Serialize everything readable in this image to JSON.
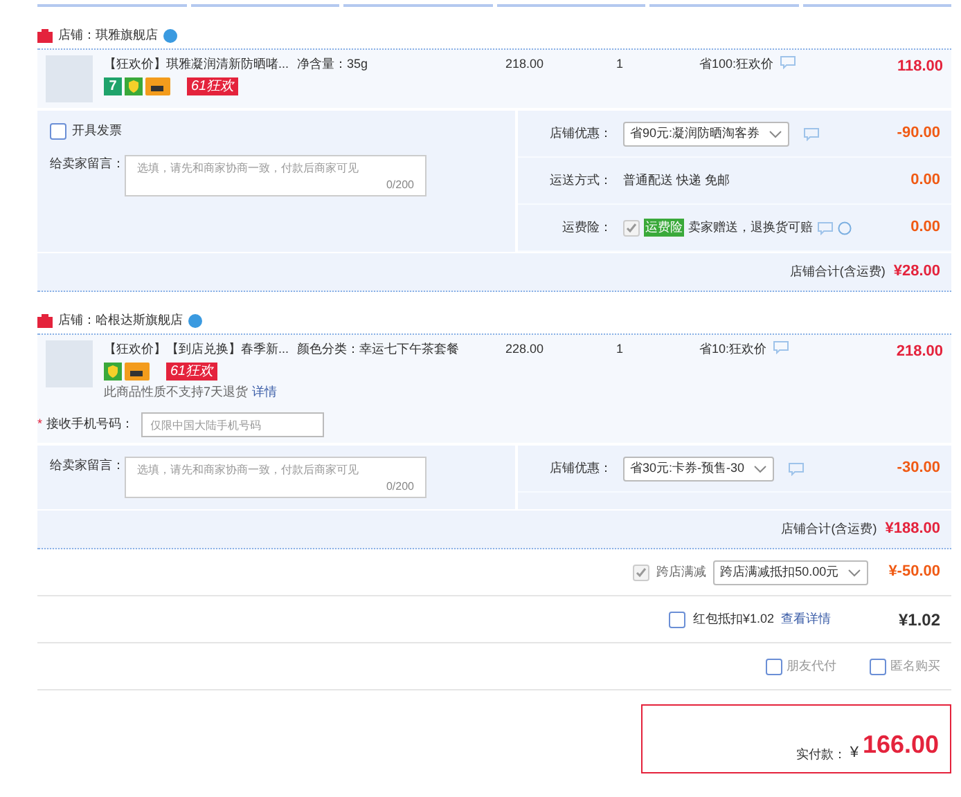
{
  "stores": [
    {
      "name": "店铺：琪雅旗舰店",
      "product": {
        "title": "【狂欢价】琪雅凝润清新防晒啫...",
        "spec": "净含量：35g",
        "price": "218.00",
        "qty": "1",
        "discount": "省100:狂欢价",
        "subtotal": "118.00",
        "badges": [
          {
            "kind": "seven",
            "text": "7"
          },
          {
            "kind": "shield"
          },
          {
            "kind": "card"
          },
          {
            "kind": "promo",
            "text": "61狂欢"
          }
        ]
      },
      "invoice": {
        "label": "开具发票",
        "checked": false
      },
      "message": {
        "label": "给卖家留言：",
        "placeholder": "选填，请先和商家协商一致，付款后商家可见",
        "counter": "0/200"
      },
      "options": [
        {
          "kind": "select",
          "label": "店铺优惠：",
          "value": "省90元:凝润防晒淘客券",
          "amount": "-90.00"
        },
        {
          "kind": "text",
          "label": "运送方式：",
          "value": "普通配送 快递 免邮",
          "amount": "0.00"
        },
        {
          "kind": "insurance",
          "label": "运费险：",
          "checked": true,
          "tag": "运费险",
          "value": "卖家赠送，退换货可赔",
          "amount": "0.00"
        }
      ],
      "total_label": "店铺合计(含运费)",
      "total": "¥28.00"
    },
    {
      "name": "店铺：哈根达斯旗舰店",
      "product": {
        "title": "【狂欢价】【到店兑换】春季新...",
        "spec": "颜色分类：幸运七下午茶套餐",
        "price": "228.00",
        "qty": "1",
        "discount": "省10:狂欢价",
        "subtotal": "218.00",
        "badges": [
          {
            "kind": "shield"
          },
          {
            "kind": "card"
          },
          {
            "kind": "promo",
            "text": "61狂欢"
          }
        ],
        "note": "此商品性质不支持7天退货",
        "note_link": "详情"
      },
      "phone": {
        "required_mark": "*",
        "label": "接收手机号码：",
        "placeholder": "仅限中国大陆手机号码"
      },
      "message": {
        "label": "给卖家留言：",
        "placeholder": "选填，请先和商家协商一致，付款后商家可见",
        "counter": "0/200"
      },
      "options": [
        {
          "kind": "select",
          "label": "店铺优惠：",
          "value": "省30元:卡券-预售-30",
          "amount": "-30.00"
        }
      ],
      "total_label": "店铺合计(含运费)",
      "total": "¥188.00"
    }
  ],
  "cross_store": {
    "checked": true,
    "label": "跨店满减",
    "value": "跨店满减抵扣50.00元",
    "amount": "¥-50.00"
  },
  "red_packet": {
    "checked": false,
    "label": "红包抵扣¥1.02",
    "link": "查看详情",
    "amount": "¥1.02"
  },
  "extras": [
    {
      "label": "朋友代付",
      "checked": false
    },
    {
      "label": "匿名购买",
      "checked": false
    }
  ],
  "pay": {
    "label": "实付款：",
    "currency": "¥",
    "amount": "166.00"
  }
}
